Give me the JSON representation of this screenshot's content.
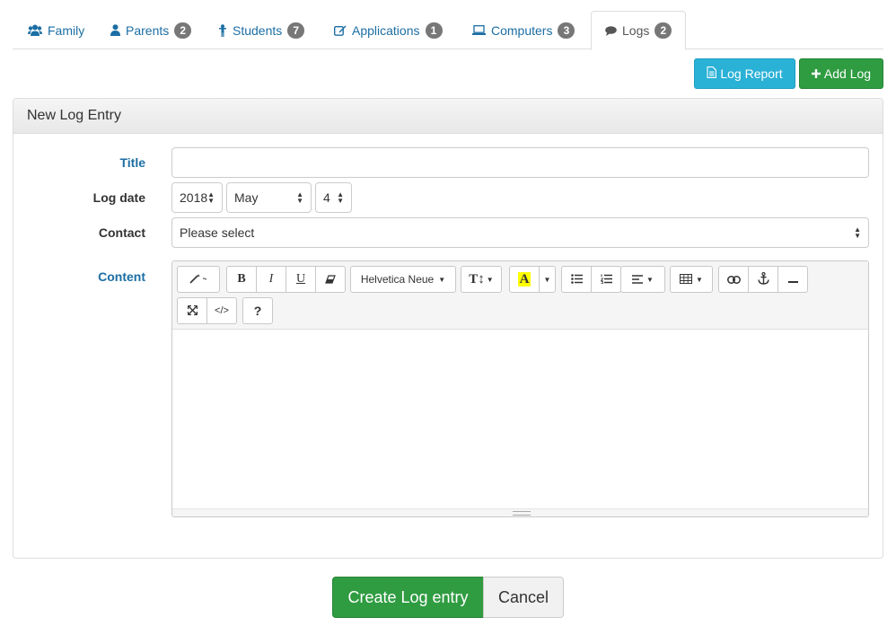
{
  "tabs": [
    {
      "label": "Family",
      "icon": "users-icon",
      "badge": ""
    },
    {
      "label": "Parents",
      "icon": "user-icon",
      "badge": "2"
    },
    {
      "label": "Students",
      "icon": "child-icon",
      "badge": "7"
    },
    {
      "label": "Applications",
      "icon": "edit-icon",
      "badge": "1"
    },
    {
      "label": "Computers",
      "icon": "laptop-icon",
      "badge": "3"
    },
    {
      "label": "Logs",
      "icon": "comment-icon",
      "badge": "2",
      "active": true
    }
  ],
  "actions": {
    "log_report": "Log Report",
    "add_log": "Add Log"
  },
  "panel": {
    "title": "New Log Entry"
  },
  "form": {
    "title_label": "Title",
    "title_value": "",
    "log_date_label": "Log date",
    "year": "2018",
    "month": "May",
    "day": "4",
    "contact_label": "Contact",
    "contact_value": "Please select",
    "content_label": "Content"
  },
  "editor": {
    "font_name": "Helvetica Neue",
    "bold": "B",
    "italic": "I",
    "underline": "U",
    "color_letter": "A",
    "help": "?",
    "code": "</>"
  },
  "footer": {
    "create": "Create Log entry",
    "cancel": "Cancel"
  },
  "colors": {
    "link": "#1c6ea4",
    "info": "#2ab1d6",
    "success": "#2f9c41",
    "badge": "#777777",
    "highlight": "#ffff00"
  }
}
